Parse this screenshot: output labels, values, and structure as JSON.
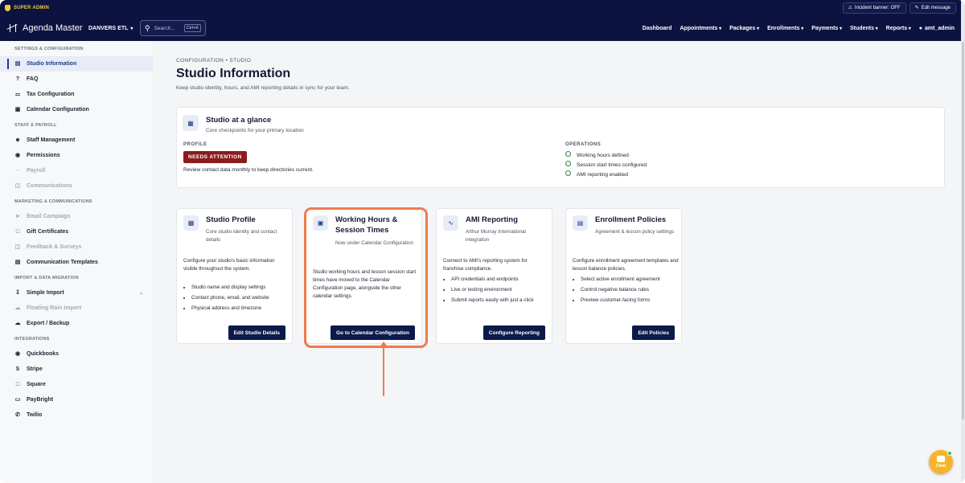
{
  "topbar": {
    "role": "SUPER ADMIN",
    "incident_banner": "Incident banner: OFF",
    "edit_message": "Edit message"
  },
  "nav": {
    "app_title": "Agenda Master",
    "location": "DANVERS ETL",
    "search_placeholder": "Search...",
    "search_shortcut": "Ctrl+K",
    "menu": [
      "Dashboard",
      "Appointments",
      "Packages",
      "Enrollments",
      "Payments",
      "Students",
      "Reports"
    ],
    "user": "amt_admin"
  },
  "sidebar": {
    "sections": [
      {
        "title": "SETTINGS & CONFIGURATION",
        "items": [
          {
            "label": "Studio Information",
            "icon": "id-card-icon",
            "active": true
          },
          {
            "label": "FAQ",
            "icon": "question-icon"
          },
          {
            "label": "Tax Configuration",
            "icon": "bank-icon"
          },
          {
            "label": "Calendar Configuration",
            "icon": "calendar-icon"
          }
        ]
      },
      {
        "title": "STAFF & PAYROLL",
        "items": [
          {
            "label": "Staff Management",
            "icon": "users-icon"
          },
          {
            "label": "Permissions",
            "icon": "key-icon"
          },
          {
            "label": "Payroll",
            "icon": "payroll-icon",
            "disabled": true
          },
          {
            "label": "Communications",
            "icon": "chat-icon",
            "disabled": true
          }
        ]
      },
      {
        "title": "MARKETING & COMMUNICATIONS",
        "items": [
          {
            "label": "Email Campaign",
            "icon": "megaphone-icon",
            "disabled": true
          },
          {
            "label": "Gift Certificates",
            "icon": "gift-icon"
          },
          {
            "label": "Feedback & Surveys",
            "icon": "feedback-icon",
            "disabled": true
          },
          {
            "label": "Communication Templates",
            "icon": "template-icon"
          }
        ]
      },
      {
        "title": "IMPORT & DATA MIGRATION",
        "items": [
          {
            "label": "Simple Import",
            "icon": "import-icon",
            "expandable": true
          },
          {
            "label": "Floating Rain Import",
            "icon": "cloud-icon",
            "disabled": true
          },
          {
            "label": "Export / Backup",
            "icon": "export-icon"
          }
        ]
      },
      {
        "title": "INTEGRATIONS",
        "items": [
          {
            "label": "Quickbooks",
            "icon": "quickbooks-icon"
          },
          {
            "label": "Stripe",
            "icon": "stripe-icon"
          },
          {
            "label": "Square",
            "icon": "square-icon"
          },
          {
            "label": "PayBright",
            "icon": "paybright-icon"
          },
          {
            "label": "Twilio",
            "icon": "phone-icon"
          }
        ]
      }
    ]
  },
  "page": {
    "breadcrumb": "CONFIGURATION • STUDIO",
    "title": "Studio Information",
    "subtitle": "Keep studio identity, hours, and AMI reporting details in sync for your team."
  },
  "glance": {
    "title": "Studio at a glance",
    "subtitle": "Core checkpoints for your primary location",
    "profile_label": "PROFILE",
    "status": "NEEDS ATTENTION",
    "note": "Review contact data monthly to keep directories current.",
    "operations_label": "OPERATIONS",
    "operations": [
      "Working hours defined",
      "Session start times configured",
      "AMI reporting enabled"
    ]
  },
  "cards": [
    {
      "title": "Studio Profile",
      "subtitle": "Core studio identity and contact details",
      "description": "Configure your studio's basic information visible throughout the system.",
      "bullets": [
        "Studio name and display settings",
        "Contact phone, email, and website",
        "Physical address and timezone"
      ],
      "button": "Edit Studio Details"
    },
    {
      "title": "Working Hours & Session Times",
      "subtitle": "Now under Calendar Configuration",
      "description": "Studio working hours and lesson session start times have moved to the Calendar Configuration page, alongside the other calendar settings.",
      "bullets": [],
      "button": "Go to Calendar Configuration"
    },
    {
      "title": "AMI Reporting",
      "subtitle": "Arthur Murray International integration",
      "description": "Connect to AMI's reporting system for franchise compliance.",
      "bullets": [
        "API credentials and endpoints",
        "Live or testing environment",
        "Submit reports easily with just a click"
      ],
      "button": "Configure Reporting"
    },
    {
      "title": "Enrollment Policies",
      "subtitle": "Agreement & lesson policy settings",
      "description": "Configure enrollment agreement templates and lesson balance policies.",
      "bullets": [
        "Select active enrollment agreement",
        "Control negative balance rules",
        "Preview customer-facing forms"
      ],
      "button": "Edit Policies"
    }
  ],
  "chat": {
    "label": "Chat"
  },
  "colors": {
    "navy": "#0c1340",
    "accent": "#1e3a8a",
    "badge": "#8c1c1c",
    "highlight": "#f07b4c",
    "chat": "#f6b42c"
  }
}
